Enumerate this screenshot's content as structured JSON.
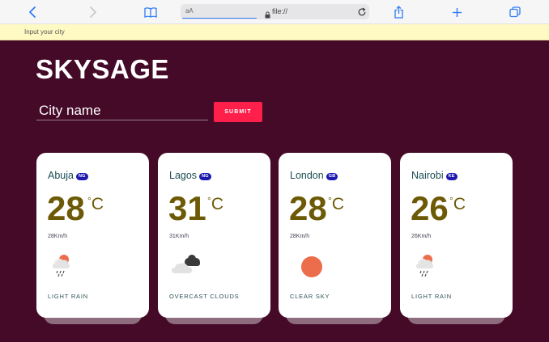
{
  "browser": {
    "text_size": "aA",
    "url": "file://"
  },
  "prompt": {
    "text": "Input your city"
  },
  "app": {
    "title": "SKYSAGE",
    "input_placeholder": "City name",
    "submit_label": "SUBMIT"
  },
  "cards": [
    {
      "city": "Abuja",
      "country": "NG",
      "temp": "28",
      "unit": "C",
      "wind": "28Km/h",
      "icon": "light-rain-icon",
      "description": "LIGHT RAIN"
    },
    {
      "city": "Lagos",
      "country": "NG",
      "temp": "31",
      "unit": "C",
      "wind": "31Km/h",
      "icon": "overcast-clouds-icon",
      "description": "OVERCAST CLOUDS"
    },
    {
      "city": "London",
      "country": "GB",
      "temp": "28",
      "unit": "C",
      "wind": "28Km/h",
      "icon": "clear-sky-icon",
      "description": "CLEAR SKY"
    },
    {
      "city": "Nairobi",
      "country": "KE",
      "temp": "26",
      "unit": "C",
      "wind": "26Km/h",
      "icon": "light-rain-icon",
      "description": "LIGHT RAIN"
    }
  ],
  "colors": {
    "background": "#450a28",
    "submit": "#ff1f4b",
    "temperature": "#6d5a06",
    "badge": "#1e1ab0",
    "sun": "#ec6d4b"
  }
}
